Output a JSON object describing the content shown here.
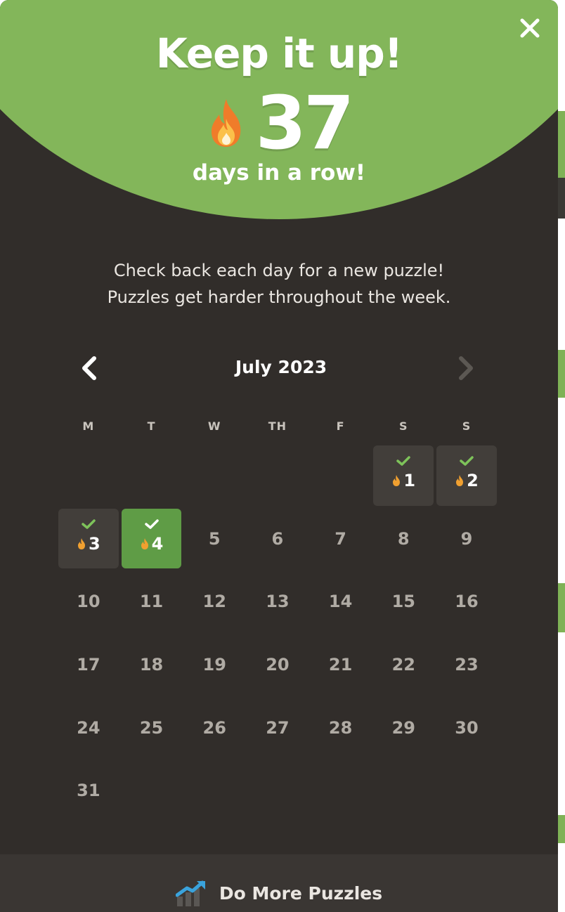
{
  "header": {
    "title": "Keep it up!",
    "streak_count": "37",
    "streak_suffix": "days in a row!",
    "close_icon": "close-icon",
    "accent_color": "#83b65a"
  },
  "message": {
    "line1": "Check back each day for a new puzzle!",
    "line2": "Puzzles get harder throughout the week."
  },
  "calendar": {
    "month_label": "July 2023",
    "prev_icon": "chevron-left-icon",
    "next_icon": "chevron-right-icon",
    "next_enabled": false,
    "weekdays": [
      "M",
      "T",
      "W",
      "TH",
      "F",
      "S",
      "S"
    ],
    "weeks": [
      [
        null,
        null,
        null,
        null,
        null,
        {
          "day": "1",
          "completed": true
        },
        {
          "day": "2",
          "completed": true
        }
      ],
      [
        {
          "day": "3",
          "completed": true
        },
        {
          "day": "4",
          "completed": true,
          "today": true
        },
        {
          "day": "5"
        },
        {
          "day": "6"
        },
        {
          "day": "7"
        },
        {
          "day": "8"
        },
        {
          "day": "9"
        }
      ],
      [
        {
          "day": "10"
        },
        {
          "day": "11"
        },
        {
          "day": "12"
        },
        {
          "day": "13"
        },
        {
          "day": "14"
        },
        {
          "day": "15"
        },
        {
          "day": "16"
        }
      ],
      [
        {
          "day": "17"
        },
        {
          "day": "18"
        },
        {
          "day": "19"
        },
        {
          "day": "20"
        },
        {
          "day": "21"
        },
        {
          "day": "22"
        },
        {
          "day": "23"
        }
      ],
      [
        {
          "day": "24"
        },
        {
          "day": "25"
        },
        {
          "day": "26"
        },
        {
          "day": "27"
        },
        {
          "day": "28"
        },
        {
          "day": "29"
        },
        {
          "day": "30"
        }
      ],
      [
        {
          "day": "31"
        },
        null,
        null,
        null,
        null,
        null,
        null
      ]
    ],
    "colors": {
      "completed_bg": "#423e3a",
      "today_bg": "#5f9c46",
      "check": "#7ec35a",
      "flame": "#f0a030"
    }
  },
  "footer": {
    "label": "Do More Puzzles",
    "icon": "trending-chart-icon"
  }
}
